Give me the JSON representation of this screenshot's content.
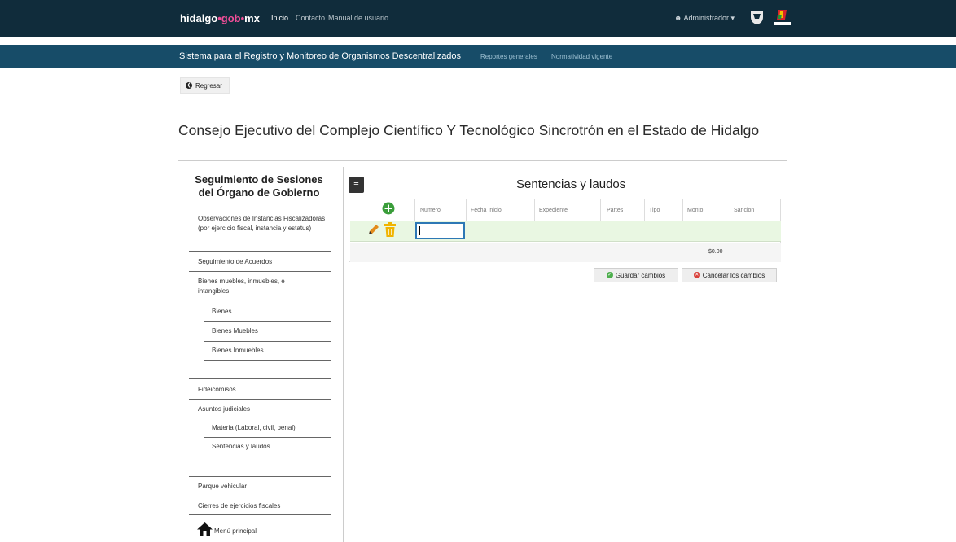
{
  "topbar": {
    "brand": {
      "part1": "hidalgo",
      "part2": "gob",
      "part3": "mx"
    },
    "nav": [
      "Inicio",
      "Contacto",
      "Manual de usuario"
    ],
    "user": "Administrador"
  },
  "subbar": {
    "title": "Sistema para el Registro y Monitoreo de Organismos Descentralizados",
    "links": [
      "Reportes generales",
      "Normatividad vigente"
    ]
  },
  "back_label": "Regresar",
  "page_title": "Consejo Ejecutivo del Complejo Científico Y Tecnológico Sincrotrón en el Estado de Hidalgo",
  "sidebar": {
    "title": "Seguimiento de Sesiones del Órgano de Gobierno",
    "items": [
      "Observaciones de Instancias Fiscalizadoras (por ejercicio fiscal, instancia y estatus)",
      "Seguimiento de Acuerdos",
      "Bienes muebles, inmuebles, e intangibles",
      "Bienes",
      "Bienes Muebles",
      "Bienes Inmuebles",
      "Fideicomisos",
      "Asuntos judiciales",
      "Materia (Laboral, civil, penal)",
      "Sentencias y laudos",
      "Parque vehicular",
      "Cierres de ejercicios fiscales",
      "Menú principal"
    ]
  },
  "grid": {
    "title": "Sentencias y laudos",
    "columns": [
      "Numero",
      "Fecha Inicio",
      "Expediente",
      "Partes",
      "Tipo",
      "Monto",
      "Sancion"
    ],
    "editing_value": "",
    "total": "$0.00"
  },
  "buttons": {
    "save": "Guardar cambios",
    "cancel": "Cancelar los cambios"
  },
  "colors": {
    "topbar": "#102c3b",
    "subbar": "#174c68",
    "accent_pink": "#f04e98",
    "row_green": "#e9f7e2"
  }
}
